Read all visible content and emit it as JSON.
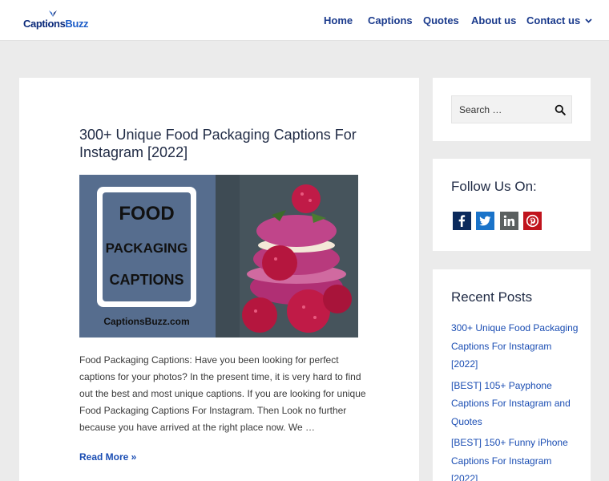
{
  "header": {
    "logo": {
      "text_part1": "Captions",
      "text_part2": "Buzz",
      "colors": {
        "part1": "#0b2a7a",
        "part2": "#1e5ec8"
      }
    },
    "nav": [
      {
        "label": "Home"
      },
      {
        "label": "Captions"
      },
      {
        "label": "Quotes"
      },
      {
        "label": "About us"
      },
      {
        "label": "Contact us",
        "icon": "chevron-down-icon"
      }
    ]
  },
  "post": {
    "title": "300+ Unique Food Packaging Captions For Instagram [2022]",
    "image": {
      "line1": "FOOD",
      "line2": "PACKAGING",
      "line3": "CAPTIONS",
      "site": "CaptionsBuzz.com"
    },
    "excerpt": "Food Packaging Captions: Have you been looking for perfect captions for your photos? In the present time, it is very hard to find out the best and most unique captions. If you are looking for unique Food Packaging Captions For Instagram. Then Look no further because you have arrived at the right place now. We …",
    "read_more": "Read More »"
  },
  "sidebar": {
    "search": {
      "placeholder": "Search …",
      "icon": "search-icon"
    },
    "follow": {
      "title": "Follow Us On:",
      "icons": [
        "facebook-icon",
        "twitter-icon",
        "linkedin-icon",
        "pinterest-icon"
      ]
    },
    "recent": {
      "title": "Recent Posts",
      "items": [
        "300+ Unique Food Packaging Captions For Instagram [2022]",
        "[BEST] 105+ Payphone Captions For Instagram and Quotes",
        "[BEST] 150+ Funny iPhone Captions For Instagram [2022]"
      ]
    }
  },
  "colors": {
    "page_bg": "#ebebeb",
    "link": "#1a4db3",
    "nav": "#1a3a8c",
    "image_panel": "#566d8e"
  }
}
